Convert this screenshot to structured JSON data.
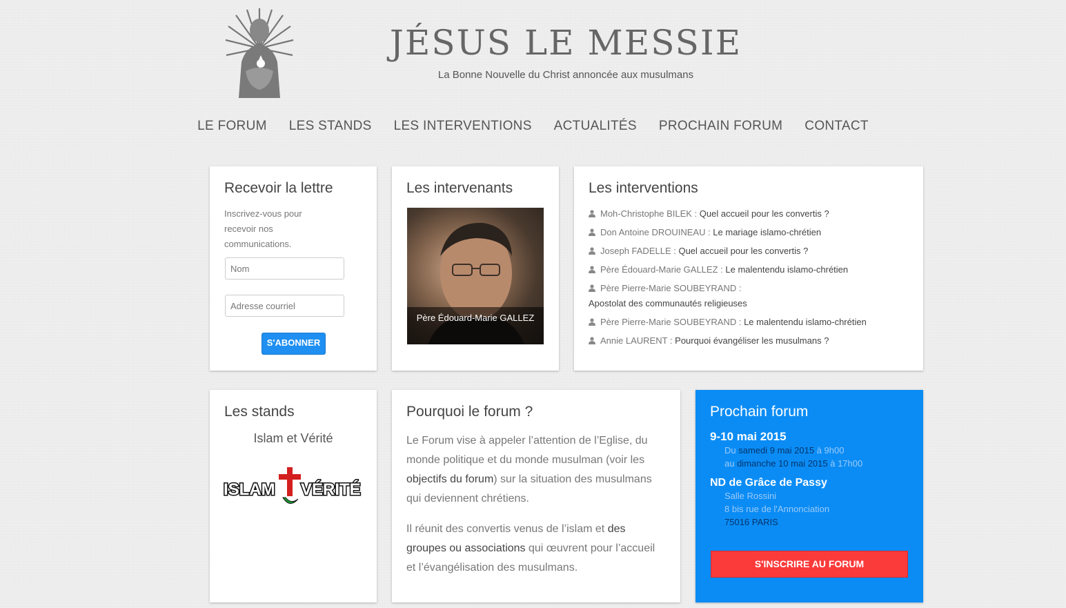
{
  "header": {
    "title": "JÉSUS LE MESSIE",
    "tagline": "La Bonne Nouvelle du Christ annoncée aux musulmans"
  },
  "nav": {
    "items": [
      "LE FORUM",
      "LES STANDS",
      "LES INTERVENTIONS",
      "ACTUALITÉS",
      "PROCHAIN FORUM",
      "CONTACT"
    ]
  },
  "newsletter": {
    "title": "Recevoir la lettre",
    "text": "Inscrivez-vous pour recevoir nos communications.",
    "name_placeholder": "Nom",
    "email_placeholder": "Adresse courriel",
    "button": "S'ABONNER"
  },
  "speakers": {
    "title": "Les intervenants",
    "caption": "Père Édouard-Marie GALLEZ"
  },
  "interventions": {
    "title": "Les interventions",
    "items": [
      {
        "name": "Moh-Christophe BILEK",
        "sep": " : ",
        "title": "Quel accueil pour les convertis ?"
      },
      {
        "name": "Don Antoine DROUINEAU",
        "sep": " : ",
        "title": "Le mariage islamo-chrétien"
      },
      {
        "name": "Joseph FADELLE",
        "sep": " : ",
        "title": "Quel accueil pour les convertis ?"
      },
      {
        "name": "Père Édouard-Marie GALLEZ",
        "sep": " : ",
        "title": "Le malentendu islamo-chrétien"
      },
      {
        "name": "Père Pierre-Marie SOUBEYRAND",
        "sep": " : ",
        "title": "Apostolat des communautés religieuses"
      },
      {
        "name": "Père Pierre-Marie SOUBEYRAND",
        "sep": " : ",
        "title": "Le malentendu islamo-chrétien"
      },
      {
        "name": "Annie LAURENT",
        "sep": " : ",
        "title": "Pourquoi évangéliser les musulmans ?"
      }
    ]
  },
  "stands": {
    "title": "Les stands",
    "name": "Islam et Vérité",
    "logo_left": "ISLAM",
    "logo_right": "VÉRITÉ"
  },
  "why": {
    "title": "Pourquoi le forum ?",
    "p1_a": "Le Forum vise à appeler l’attention de l’Eglise, du monde politique et du monde musulman (voir les ",
    "p1_link": "objectifs du forum",
    "p1_b": ") sur la situation des musulmans qui deviennent chrétiens.",
    "p2_a": "Il réunit des convertis venus de l’islam et ",
    "p2_link": "des groupes ou associations",
    "p2_b": " qui œuvrent pour l’accueil et l’évangélisation des musulmans."
  },
  "next_forum": {
    "title": "Prochain forum",
    "dates": "9-10 mai 2015",
    "from_label": "Du ",
    "from_date": "samedi 9 mai 2015",
    "from_time": " à 9h00",
    "to_label": "au ",
    "to_date": "dimanche 10 mai 2015",
    "to_time": " à 17h00",
    "venue": "ND de Grâce de Passy",
    "room": "Salle Rossini",
    "street": "8 bis rue de l'Annonciation",
    "city": "75016 PARIS",
    "button": "S'INSCRIRE AU FORUM"
  },
  "colors": {
    "accent_blue": "#0b8cf5",
    "button_blue": "#1f8ff2",
    "button_red": "#fb3a3a"
  }
}
